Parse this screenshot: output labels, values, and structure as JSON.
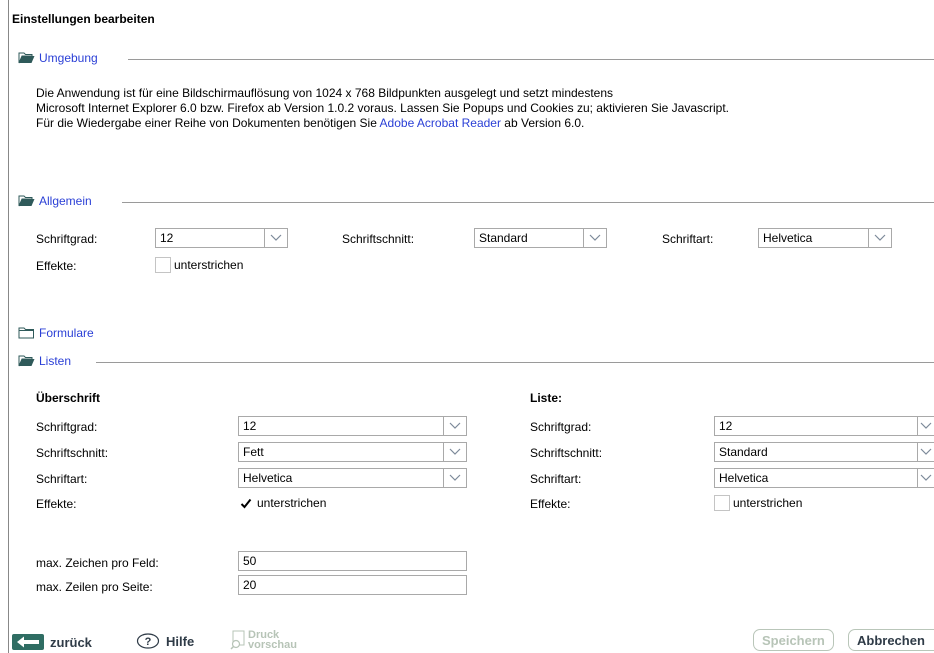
{
  "title": "Einstellungen bearbeiten",
  "sections": {
    "umgebung": "Umgebung",
    "allgemein": "Allgemein",
    "formulare": "Formulare",
    "listen": "Listen"
  },
  "umgebung_text": {
    "line1": "Die Anwendung ist für eine Bildschirmauflösung von 1024 x 768 Bildpunkten ausgelegt und setzt mindestens",
    "line2": "Microsoft Internet Explorer 6.0 bzw. Firefox ab Version 1.0.2 voraus. Lassen Sie Popups und Cookies zu; aktivieren Sie Javascript.",
    "line3_pre": "Für die Wiedergabe einer Reihe von Dokumenten benötigen Sie ",
    "line3_link": "Adobe Acrobat Reader",
    "line3_post": " ab Version 6.0."
  },
  "allgemein": {
    "schriftgrad_label": "Schriftgrad:",
    "schriftgrad_value": "12",
    "schriftschnitt_label": "Schriftschnitt:",
    "schriftschnitt_value": "Standard",
    "schriftart_label": "Schriftart:",
    "schriftart_value": "Helvetica",
    "effekte_label": "Effekte:",
    "effekte_option": "unterstrichen",
    "effekte_checked": false
  },
  "listen": {
    "ueberschrift": {
      "heading": "Überschrift",
      "schriftgrad_label": "Schriftgrad:",
      "schriftgrad_value": "12",
      "schriftschnitt_label": "Schriftschnitt:",
      "schriftschnitt_value": "Fett",
      "schriftart_label": "Schriftart:",
      "schriftart_value": "Helvetica",
      "effekte_label": "Effekte:",
      "effekte_option": "unterstrichen",
      "effekte_checked": true
    },
    "liste": {
      "heading": "Liste:",
      "schriftgrad_label": "Schriftgrad:",
      "schriftgrad_value": "12",
      "schriftschnitt_label": "Schriftschnitt:",
      "schriftschnitt_value": "Standard",
      "schriftart_label": "Schriftart:",
      "schriftart_value": "Helvetica",
      "effekte_label": "Effekte:",
      "effekte_option": "unterstrichen",
      "effekte_checked": false
    },
    "max_zeichen_label": "max. Zeichen pro Feld:",
    "max_zeichen_value": "50",
    "max_zeilen_label": "max. Zeilen pro Seite:",
    "max_zeilen_value": "20"
  },
  "footer": {
    "zurueck": "zurück",
    "hilfe": "Hilfe",
    "druck_line1": "Druck",
    "druck_line2": "vorschau",
    "speichern": "Speichern",
    "abbrechen": "Abbrechen"
  },
  "colors": {
    "link": "#2a3fd6",
    "folder": "#2f5a5a",
    "footer_text": "#2f3b47",
    "disabled": "#b7c4b7"
  },
  "icons": {
    "folder_open": "folder-open-icon",
    "folder_closed": "folder-icon",
    "back": "back-arrow-icon",
    "help": "help-icon",
    "print_preview": "print-preview-icon",
    "dropdown": "chevron-down-icon",
    "check": "checkmark-icon"
  }
}
